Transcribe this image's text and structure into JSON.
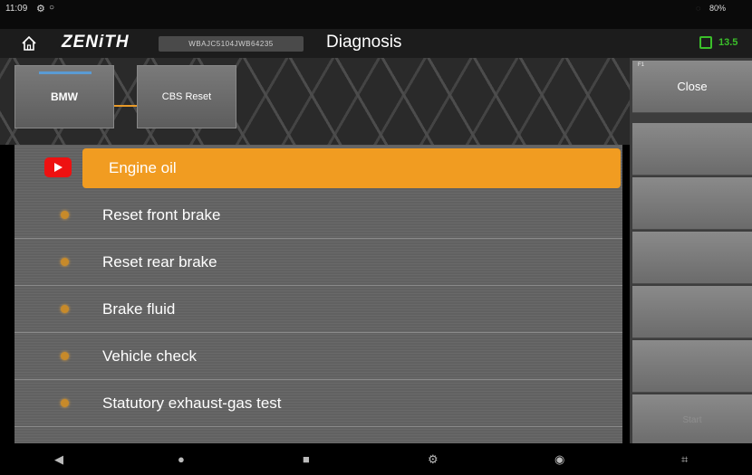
{
  "status_bar": {
    "time": "11:09",
    "battery": "80%"
  },
  "header": {
    "logo": "ZENiTH",
    "vin": "WBAJC5104JWB64235",
    "title": "Diagnosis",
    "voltage": "13.5"
  },
  "breadcrumb": {
    "items": [
      "BMW",
      "CBS Reset"
    ]
  },
  "list": {
    "items": [
      {
        "label": "Engine oil"
      },
      {
        "label": "Reset front brake"
      },
      {
        "label": "Reset rear brake"
      },
      {
        "label": "Brake fluid"
      },
      {
        "label": "Vehicle check"
      },
      {
        "label": "Statutory exhaust-gas test"
      }
    ]
  },
  "side_panel": {
    "f1_key": "F1",
    "close_label": "Close",
    "disabled_label": "Start"
  },
  "colors": {
    "accent": "#f19c21",
    "ok": "#3bbf2a",
    "video": "#e11"
  },
  "icons": {
    "home": "home-icon",
    "video": "video-play-icon",
    "back": "back-triangle-icon",
    "home_nav": "home-circle-icon",
    "recents": "recents-square-icon",
    "settings": "gear-icon",
    "chrome": "browser-icon",
    "screenshot": "screenshot-icon"
  }
}
